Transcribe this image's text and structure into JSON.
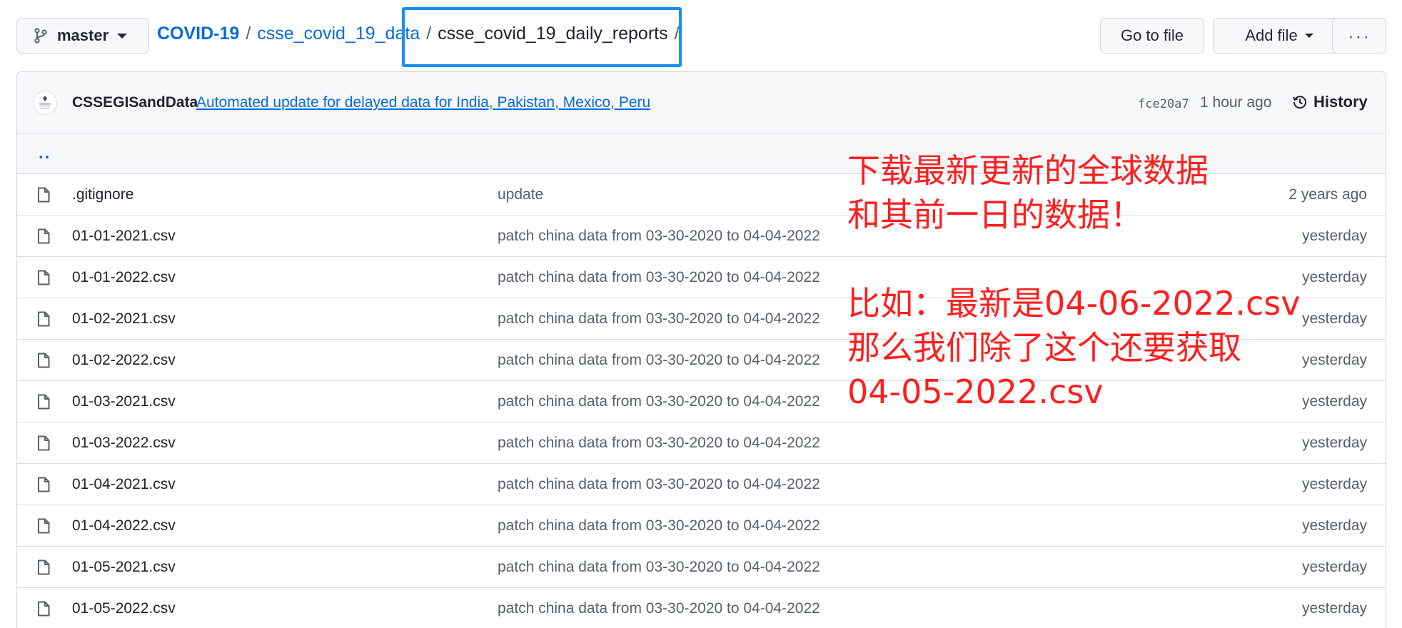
{
  "branch": {
    "label": "master"
  },
  "breadcrumb": {
    "root": "COVID-19",
    "separator": "/",
    "level1": "csse_covid_19_data",
    "current": "csse_covid_19_daily_reports",
    "trailing": "/"
  },
  "toolbar": {
    "go_to_file": "Go to file",
    "add_file": "Add file",
    "more": "···"
  },
  "commit": {
    "author": "CSSEGISandData",
    "message": "Automated update for delayed data for India, Pakistan, Mexico, Peru",
    "sha": "fce20a7",
    "time": "1 hour ago",
    "history_label": "History"
  },
  "parent_dir": "..",
  "files": [
    {
      "name": ".gitignore",
      "message": "update",
      "age": "2 years ago"
    },
    {
      "name": "01-01-2021.csv",
      "message": "patch china data from 03-30-2020 to 04-04-2022",
      "age": "yesterday"
    },
    {
      "name": "01-01-2022.csv",
      "message": "patch china data from 03-30-2020 to 04-04-2022",
      "age": "yesterday"
    },
    {
      "name": "01-02-2021.csv",
      "message": "patch china data from 03-30-2020 to 04-04-2022",
      "age": "yesterday"
    },
    {
      "name": "01-02-2022.csv",
      "message": "patch china data from 03-30-2020 to 04-04-2022",
      "age": "yesterday"
    },
    {
      "name": "01-03-2021.csv",
      "message": "patch china data from 03-30-2020 to 04-04-2022",
      "age": "yesterday"
    },
    {
      "name": "01-03-2022.csv",
      "message": "patch china data from 03-30-2020 to 04-04-2022",
      "age": "yesterday"
    },
    {
      "name": "01-04-2021.csv",
      "message": "patch china data from 03-30-2020 to 04-04-2022",
      "age": "yesterday"
    },
    {
      "name": "01-04-2022.csv",
      "message": "patch china data from 03-30-2020 to 04-04-2022",
      "age": "yesterday"
    },
    {
      "name": "01-05-2021.csv",
      "message": "patch china data from 03-30-2020 to 04-04-2022",
      "age": "yesterday"
    },
    {
      "name": "01-05-2022.csv",
      "message": "patch china data from 03-30-2020 to 04-04-2022",
      "age": "yesterday"
    }
  ],
  "annotation": {
    "line1": "下载最新更新的全球数据",
    "line2": "和其前一日的数据！",
    "line3": "比如：最新是04-06-2022.csv",
    "line4": "那么我们除了这个还要获取",
    "line5": "04-05-2022.csv"
  },
  "colors": {
    "link": "#0969da",
    "highlight_box": "#1a8ef0",
    "annotation": "#ff1e1e",
    "muted": "#57606a"
  }
}
